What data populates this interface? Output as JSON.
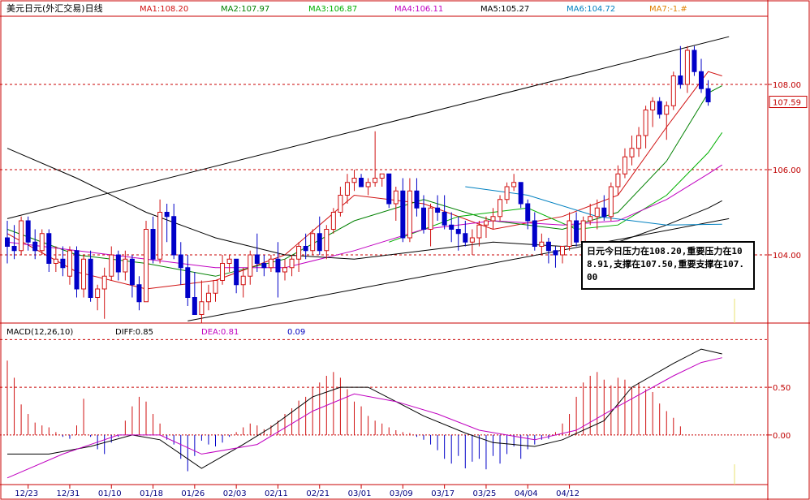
{
  "chart_data": [
    {
      "type": "candlestick",
      "title": "美元日元(外汇交易)日线",
      "ma_labels": [
        {
          "text": "MA1:108.20",
          "color": "#d01010"
        },
        {
          "text": "MA2:107.97",
          "color": "#008000"
        },
        {
          "text": "MA3:106.87",
          "color": "#00b000"
        },
        {
          "text": "MA4:106.11",
          "color": "#c000c0"
        },
        {
          "text": "MA5:105.27",
          "color": "#000000"
        },
        {
          "text": "MA6:104.72",
          "color": "#0080c0"
        },
        {
          "text": "MA7:-1.#",
          "color": "#e08000"
        }
      ],
      "ylim": [
        102.4,
        109.6
      ],
      "y_ticks": [
        "108.00",
        "106.00",
        "104.00"
      ],
      "y_tick_values": [
        108,
        106,
        104
      ],
      "last_price_label": "107.59",
      "last_price": 107.59,
      "x_tick_labels": [
        "12/23",
        "12/31",
        "01/10",
        "01/18",
        "01/26",
        "02/03",
        "02/11",
        "02/21",
        "03/01",
        "03/09",
        "03/17",
        "03/25",
        "04/04",
        "04/12"
      ],
      "x_tick_index": [
        3,
        9,
        15,
        21,
        27,
        33,
        39,
        45,
        51,
        57,
        63,
        69,
        75,
        81
      ],
      "candles": [
        [
          104.4,
          104.8,
          103.8,
          104.2
        ],
        [
          104.2,
          104.7,
          103.9,
          104.1
        ],
        [
          104.1,
          104.9,
          104.0,
          104.8
        ],
        [
          104.8,
          104.9,
          104.1,
          104.3
        ],
        [
          104.3,
          104.6,
          103.9,
          104.1
        ],
        [
          104.1,
          104.6,
          104.0,
          104.5
        ],
        [
          104.5,
          104.6,
          103.6,
          103.8
        ],
        [
          103.8,
          104.2,
          103.6,
          103.9
        ],
        [
          103.9,
          104.2,
          103.5,
          103.7
        ],
        [
          103.5,
          104.2,
          103.3,
          104.1
        ],
        [
          104.1,
          104.2,
          103.0,
          103.2
        ],
        [
          103.2,
          104.0,
          103.0,
          103.9
        ],
        [
          103.9,
          104.1,
          102.9,
          103.0
        ],
        [
          103.0,
          103.3,
          102.7,
          103.2
        ],
        [
          103.2,
          103.7,
          102.5,
          103.5
        ],
        [
          103.5,
          104.2,
          103.4,
          104.0
        ],
        [
          104.0,
          104.1,
          103.4,
          103.6
        ],
        [
          103.6,
          104.1,
          103.4,
          103.9
        ],
        [
          103.9,
          104.0,
          103.0,
          103.3
        ],
        [
          103.3,
          103.5,
          102.7,
          102.9
        ],
        [
          102.9,
          104.8,
          102.9,
          104.6
        ],
        [
          104.6,
          104.9,
          103.8,
          103.9
        ],
        [
          103.9,
          105.3,
          103.8,
          105.0
        ],
        [
          105.0,
          105.2,
          104.3,
          104.9
        ],
        [
          104.9,
          105.2,
          103.9,
          104.0
        ],
        [
          104.0,
          104.3,
          103.3,
          103.7
        ],
        [
          103.7,
          104.0,
          102.8,
          103.0
        ],
        [
          103.0,
          103.6,
          102.8,
          102.6
        ],
        [
          102.6,
          103.4,
          102.4,
          102.9
        ],
        [
          102.9,
          103.3,
          102.7,
          103.1
        ],
        [
          103.1,
          103.4,
          102.9,
          103.4
        ],
        [
          103.4,
          104.0,
          103.3,
          103.8
        ],
        [
          103.8,
          104.0,
          103.6,
          103.9
        ],
        [
          103.9,
          103.8,
          103.1,
          103.3
        ],
        [
          103.3,
          103.7,
          103.0,
          103.5
        ],
        [
          103.5,
          104.1,
          103.3,
          104.0
        ],
        [
          104.0,
          104.5,
          103.6,
          103.8
        ],
        [
          103.8,
          104.0,
          103.5,
          103.7
        ],
        [
          103.7,
          104.0,
          103.6,
          103.9
        ],
        [
          103.9,
          104.3,
          103.0,
          103.6
        ],
        [
          103.6,
          103.9,
          103.4,
          103.7
        ],
        [
          103.7,
          104.0,
          103.5,
          103.9
        ],
        [
          103.9,
          104.3,
          103.6,
          104.2
        ],
        [
          104.2,
          104.5,
          103.9,
          104.1
        ],
        [
          104.1,
          104.6,
          104.0,
          104.5
        ],
        [
          104.5,
          104.9,
          104.0,
          104.1
        ],
        [
          104.1,
          104.7,
          103.9,
          104.6
        ],
        [
          104.6,
          105.1,
          104.5,
          105.0
        ],
        [
          105.0,
          105.6,
          104.9,
          105.4
        ],
        [
          105.4,
          105.9,
          105.2,
          105.7
        ],
        [
          105.7,
          106.0,
          105.5,
          105.8
        ],
        [
          105.8,
          105.9,
          105.6,
          105.6
        ],
        [
          105.6,
          105.8,
          105.4,
          105.7
        ],
        [
          105.7,
          106.9,
          105.6,
          105.8
        ],
        [
          105.8,
          105.9,
          105.6,
          105.9
        ],
        [
          105.9,
          105.7,
          105.1,
          105.2
        ],
        [
          105.2,
          105.6,
          104.8,
          105.5
        ],
        [
          105.5,
          105.8,
          104.3,
          104.4
        ],
        [
          104.4,
          105.8,
          104.3,
          105.5
        ],
        [
          105.5,
          105.8,
          104.9,
          105.1
        ],
        [
          105.1,
          105.4,
          104.5,
          104.6
        ],
        [
          104.6,
          105.2,
          104.2,
          105.1
        ],
        [
          105.1,
          105.4,
          104.8,
          105.0
        ],
        [
          105.0,
          105.4,
          104.6,
          104.7
        ],
        [
          104.7,
          105.0,
          104.3,
          104.6
        ],
        [
          104.6,
          104.9,
          104.1,
          104.5
        ],
        [
          104.5,
          104.8,
          104.2,
          104.3
        ],
        [
          104.3,
          104.6,
          104.0,
          104.4
        ],
        [
          104.4,
          104.8,
          104.2,
          104.7
        ],
        [
          104.7,
          104.9,
          104.4,
          104.8
        ],
        [
          104.8,
          105.1,
          104.6,
          104.9
        ],
        [
          104.9,
          105.4,
          104.8,
          105.3
        ],
        [
          105.3,
          105.7,
          105.2,
          105.6
        ],
        [
          105.6,
          105.9,
          105.5,
          105.7
        ],
        [
          105.7,
          105.6,
          105.1,
          105.2
        ],
        [
          105.2,
          105.3,
          104.6,
          104.8
        ],
        [
          104.8,
          105.0,
          104.1,
          104.2
        ],
        [
          104.2,
          104.5,
          104.0,
          104.3
        ],
        [
          104.3,
          104.4,
          103.8,
          104.1
        ],
        [
          104.1,
          104.2,
          103.7,
          104.0
        ],
        [
          104.0,
          104.2,
          103.8,
          104.2
        ],
        [
          104.2,
          105.0,
          104.1,
          104.8
        ],
        [
          104.8,
          105.0,
          104.2,
          104.3
        ],
        [
          104.3,
          104.9,
          104.2,
          104.8
        ],
        [
          104.8,
          105.2,
          104.7,
          104.9
        ],
        [
          104.9,
          105.3,
          104.6,
          105.1
        ],
        [
          105.1,
          105.4,
          104.8,
          104.9
        ],
        [
          104.9,
          105.7,
          104.8,
          105.6
        ],
        [
          105.6,
          106.1,
          105.4,
          105.9
        ],
        [
          105.9,
          106.5,
          105.8,
          106.3
        ],
        [
          106.3,
          106.8,
          106.1,
          106.5
        ],
        [
          106.5,
          107.0,
          106.3,
          106.8
        ],
        [
          106.8,
          107.5,
          106.5,
          107.4
        ],
        [
          107.4,
          107.7,
          107.0,
          107.6
        ],
        [
          107.6,
          107.7,
          107.2,
          107.3
        ],
        [
          107.3,
          107.6,
          106.7,
          107.5
        ],
        [
          107.5,
          108.3,
          107.4,
          108.2
        ],
        [
          108.2,
          108.9,
          107.9,
          108.0
        ],
        [
          108.0,
          108.9,
          107.8,
          108.8
        ],
        [
          108.8,
          108.9,
          108.2,
          108.3
        ],
        [
          108.3,
          108.6,
          107.8,
          107.9
        ],
        [
          107.9,
          108.1,
          107.5,
          107.59
        ]
      ],
      "ma": [
        {
          "name": "MA1",
          "color": "#d01010",
          "values": [
            [
              0,
              104.5
            ],
            [
              10,
              103.6
            ],
            [
              20,
              103.2
            ],
            [
              30,
              103.4
            ],
            [
              40,
              104.0
            ],
            [
              50,
              105.4
            ],
            [
              60,
              105.2
            ],
            [
              70,
              104.6
            ],
            [
              80,
              104.9
            ],
            [
              88,
              105.4
            ],
            [
              95,
              107.0
            ],
            [
              101,
              108.3
            ],
            [
              103,
              108.2
            ]
          ]
        },
        {
          "name": "MA2",
          "color": "#008000",
          "values": [
            [
              0,
              104.6
            ],
            [
              10,
              104.0
            ],
            [
              20,
              103.8
            ],
            [
              30,
              103.5
            ],
            [
              40,
              103.9
            ],
            [
              50,
              104.8
            ],
            [
              60,
              105.3
            ],
            [
              70,
              104.8
            ],
            [
              80,
              104.6
            ],
            [
              88,
              105.0
            ],
            [
              95,
              106.2
            ],
            [
              101,
              107.8
            ],
            [
              103,
              107.97
            ]
          ]
        },
        {
          "name": "MA3",
          "color": "#00b000",
          "values": [
            [
              55,
              104.3
            ],
            [
              65,
              104.9
            ],
            [
              75,
              105.1
            ],
            [
              82,
              104.6
            ],
            [
              88,
              104.7
            ],
            [
              95,
              105.4
            ],
            [
              101,
              106.4
            ],
            [
              103,
              106.87
            ]
          ]
        },
        {
          "name": "MA4",
          "color": "#c000c0",
          "values": [
            [
              0,
              104.3
            ],
            [
              10,
              104.1
            ],
            [
              20,
              103.9
            ],
            [
              30,
              103.7
            ],
            [
              40,
              103.7
            ],
            [
              50,
              104.1
            ],
            [
              60,
              104.6
            ],
            [
              70,
              104.8
            ],
            [
              80,
              104.7
            ],
            [
              88,
              104.8
            ],
            [
              95,
              105.3
            ],
            [
              101,
              105.9
            ],
            [
              103,
              106.11
            ]
          ]
        },
        {
          "name": "MA5",
          "color": "#000000",
          "values": [
            [
              0,
              106.5
            ],
            [
              10,
              105.8
            ],
            [
              20,
              105.0
            ],
            [
              30,
              104.4
            ],
            [
              40,
              104.0
            ],
            [
              50,
              103.9
            ],
            [
              60,
              104.1
            ],
            [
              70,
              104.3
            ],
            [
              80,
              104.2
            ],
            [
              88,
              104.3
            ],
            [
              95,
              104.7
            ],
            [
              101,
              105.1
            ],
            [
              103,
              105.27
            ]
          ]
        },
        {
          "name": "MA6",
          "color": "#0080c0",
          "values": [
            [
              66,
              105.6
            ],
            [
              75,
              105.4
            ],
            [
              85,
              104.9
            ],
            [
              95,
              104.7
            ],
            [
              103,
              104.72
            ]
          ]
        }
      ],
      "channel_lines": [
        {
          "x": [
            0,
            104
          ],
          "y": [
            104.85,
            109.12
          ]
        },
        {
          "x": [
            26,
            104
          ],
          "y": [
            102.45,
            104.85
          ]
        }
      ]
    },
    {
      "type": "macd",
      "title": "MACD(12,26,10)",
      "labels": [
        {
          "text": "DIFF:0.85",
          "color": "#000000"
        },
        {
          "text": "DEA:0.81",
          "color": "#c000c0"
        },
        {
          "text": "0.09",
          "color": "#0000c0"
        }
      ],
      "ylim": [
        -0.52,
        1.02
      ],
      "y_ticks": [
        "0.50",
        "0.00"
      ],
      "y_tick_values": [
        0.5,
        0.0
      ],
      "diff": [
        [
          0,
          -0.2
        ],
        [
          6,
          -0.2
        ],
        [
          12,
          -0.12
        ],
        [
          18,
          0.0
        ],
        [
          22,
          -0.05
        ],
        [
          28,
          -0.35
        ],
        [
          34,
          -0.1
        ],
        [
          38,
          0.08
        ],
        [
          44,
          0.4
        ],
        [
          48,
          0.5
        ],
        [
          52,
          0.5
        ],
        [
          56,
          0.35
        ],
        [
          60,
          0.2
        ],
        [
          66,
          0.02
        ],
        [
          70,
          -0.08
        ],
        [
          76,
          -0.12
        ],
        [
          80,
          -0.05
        ],
        [
          86,
          0.15
        ],
        [
          90,
          0.5
        ],
        [
          96,
          0.75
        ],
        [
          100,
          0.9
        ],
        [
          103,
          0.85
        ]
      ],
      "dea": [
        [
          0,
          -0.45
        ],
        [
          8,
          -0.2
        ],
        [
          16,
          0.0
        ],
        [
          22,
          0.0
        ],
        [
          28,
          -0.2
        ],
        [
          36,
          -0.1
        ],
        [
          44,
          0.25
        ],
        [
          50,
          0.43
        ],
        [
          56,
          0.35
        ],
        [
          62,
          0.22
        ],
        [
          68,
          0.05
        ],
        [
          76,
          -0.05
        ],
        [
          82,
          0.05
        ],
        [
          88,
          0.3
        ],
        [
          96,
          0.62
        ],
        [
          100,
          0.76
        ],
        [
          103,
          0.81
        ]
      ],
      "hist": [
        0.78,
        0.6,
        0.32,
        0.22,
        0.13,
        0.1,
        0.08,
        0.03,
        -0.02,
        -0.04,
        0.1,
        0.38,
        -0.02,
        -0.15,
        -0.2,
        -0.08,
        -0.02,
        0.15,
        0.3,
        0.4,
        0.35,
        0.22,
        0.12,
        -0.05,
        -0.1,
        -0.25,
        -0.38,
        -0.22,
        -0.06,
        -0.1,
        -0.12,
        -0.08,
        -0.02,
        0.03,
        0.08,
        0.12,
        0.1,
        0.06,
        0.1,
        0.15,
        0.22,
        0.28,
        0.36,
        0.4,
        0.5,
        0.55,
        0.62,
        0.66,
        0.6,
        0.48,
        0.35,
        0.3,
        0.2,
        0.15,
        0.12,
        0.08,
        0.05,
        0.03,
        0.02,
        -0.02,
        -0.05,
        -0.1,
        -0.16,
        -0.25,
        -0.3,
        -0.22,
        -0.35,
        -0.28,
        -0.25,
        -0.36,
        -0.22,
        -0.3,
        -0.2,
        -0.12,
        -0.25,
        -0.15,
        -0.1,
        -0.05,
        -0.04,
        0.03,
        0.12,
        0.22,
        0.4,
        0.55,
        0.62,
        0.66,
        0.58,
        0.52,
        0.6,
        0.58,
        0.5,
        0.55,
        0.48,
        0.45,
        0.33,
        0.25,
        0.18,
        0.09
      ],
      "hist_start": 0
    }
  ],
  "annotation": {
    "text": "日元今日压力在108.20,重要压力在108.91,支撑在107.50,重要支撑在107.00"
  },
  "colors": {
    "up": "#d01010",
    "down": "#0000c8",
    "grid": "#c80000",
    "axis": "#c80000",
    "label_box": "#c80000"
  }
}
